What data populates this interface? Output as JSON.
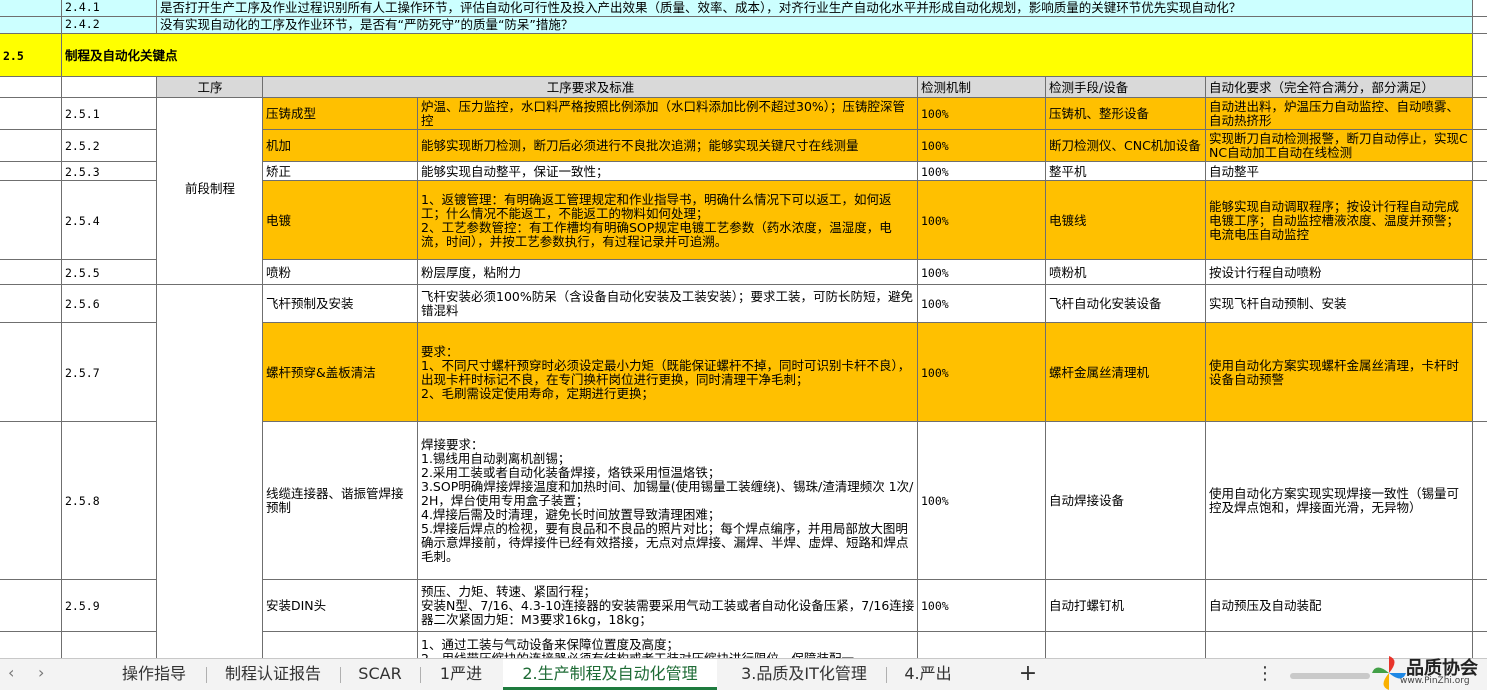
{
  "rows": {
    "r241": {
      "id": "2.4.1",
      "text": "是否打开生产工序及作业过程识别所有人工操作环节，评估自动化可行性及投入产出效果（质量、效率、成本），对齐行业生产自动化水平并形成自动化规划，影响质量的关键环节优先实现自动化？"
    },
    "r242": {
      "id": "2.4.2",
      "text": "没有实现自动化的工序及作业环节，是否有“严防死守”的质量“防呆”措施？"
    },
    "section": {
      "id": "2.5",
      "title": "制程及自动化关键点"
    },
    "header": {
      "process": "工序",
      "requirements": "工序要求及标准",
      "mechanism": "检测机制",
      "means": "检测手段/设备",
      "automation": "自动化要求（完全符合满分，部分满足）"
    },
    "group_front": "前段制程",
    "items": [
      {
        "id": "2.5.1",
        "name": "压铸成型",
        "req": "炉温、压力监控，水口料严格按照比例添加（水口料添加比例不超过30%）；压铸腔深管控",
        "mech": "100%",
        "means": "压铸机、整形设备",
        "auto": "自动进出料，炉温压力自动监控、自动喷雾、自动热挤形"
      },
      {
        "id": "2.5.2",
        "name": "机加",
        "req": "能够实现断刀检测，断刀后必须进行不良批次追溯；能够实现关键尺寸在线测量",
        "mech": "100%",
        "means": "断刀检测仪、CNC机加设备",
        "auto": "实现断刀自动检测报警，断刀自动停止，实现CNC自动加工自动在线检测"
      },
      {
        "id": "2.5.3",
        "name": "矫正",
        "req": "能够实现自动整平，保证一致性；",
        "mech": "100%",
        "means": "整平机",
        "auto": "自动整平"
      },
      {
        "id": "2.5.4",
        "name": "电镀",
        "req": "1、返镀管理：有明确返工管理规定和作业指导书，明确什么情况下可以返工，如何返工；什么情况不能返工，不能返工的物料如何处理；\n2、工艺参数管控：有工作槽均有明确SOP规定电镀工艺参数（药水浓度，温湿度，电流，时间），并按工艺参数执行，有过程记录并可追溯。",
        "mech": "100%",
        "means": "电镀线",
        "auto": "能够实现自动调取程序；按设计行程自动完成电镀工序；自动监控槽液浓度、温度并预警；电流电压自动监控"
      },
      {
        "id": "2.5.5",
        "name": "喷粉",
        "req": "粉层厚度，粘附力",
        "mech": "100%",
        "means": "喷粉机",
        "auto": "按设计行程自动喷粉"
      },
      {
        "id": "2.5.6",
        "name": "飞杆预制及安装",
        "req": "飞杆安装必须100%防呆（含设备自动化安装及工装安装）；要求工装，可防长防短，避免错混料",
        "mech": "100%",
        "means": "飞杆自动化安装设备",
        "auto": "实现飞杆自动预制、安装"
      },
      {
        "id": "2.5.7",
        "name": "螺杆预穿&盖板清洁",
        "req": "要求：\n1、不同尺寸螺杆预穿时必须设定最小力矩（既能保证螺杆不掉，同时可识别卡杆不良），出现卡杆时标记不良，在专门换杆岗位进行更换，同时清理干净毛刺；\n2、毛刷需设定使用寿命，定期进行更换；",
        "mech": "100%",
        "means": "螺杆金属丝清理机",
        "auto": "使用自动化方案实现螺杆金属丝清理，卡杆时设备自动预警"
      },
      {
        "id": "2.5.8",
        "name": "线缆连接器、谐振管焊接预制",
        "req": "焊接要求：\n1.锡线用自动剥离机剖锡；\n2.采用工装或者自动化装备焊接，烙铁采用恒温烙铁；\n3.SOP明确焊接焊接温度和加热时间、加锡量(使用锡量工装缠绕)、锡珠/渣清理频次 1次/2H，焊台使用专用盒子装置；\n4.焊接后需及时清理，避免长时间放置导致清理困难；\n5.焊接后焊点的检视，要有良品和不良品的照片对比；每个焊点编序，并用局部放大图明确示意焊接前，待焊接件已经有效搭接，无点对点焊接、漏焊、半焊、虚焊、短路和焊点毛刺。",
        "mech": "100%",
        "means": "自动焊接设备",
        "auto": "使用自动化方案实现实现焊接一致性（锡量可控及焊点饱和，焊接面光滑，无异物）"
      },
      {
        "id": "2.5.9",
        "name": "安装DIN头",
        "req": "预压、力矩、转速、紧固行程；\n安装N型、7/16、4.3-10连接器的安装需要采用气动工装或者自动化设备压紧，7/16连接器二次紧固力矩：M3要求16kg，18kg；",
        "mech": "100%",
        "means": "自动打螺钉机",
        "auto": "自动预压及自动装配"
      },
      {
        "id": "",
        "name": "",
        "req": "1、通过工装与气动设备来保障位置度及高度；\n2、用线带压缩块的连接器必须有结构或者工装对压缩块进行限位，保障装配一",
        "mech": "",
        "means": "",
        "auto": ""
      }
    ]
  },
  "tabs": [
    "操作指导",
    "制程认证报告",
    "SCAR",
    "1严进",
    "2.生产制程及自动化管理",
    "3.品质及IT化管理",
    "4.严出"
  ],
  "tab_add": "+",
  "tab_menu": "⋮",
  "logo": {
    "name": "品质协会",
    "url": "www.PinZhi.org"
  },
  "colors": {
    "cyan": "#ccffff",
    "yellow": "#ffff00",
    "orange": "#ffc000",
    "active_tab": "#1e7b3e"
  }
}
